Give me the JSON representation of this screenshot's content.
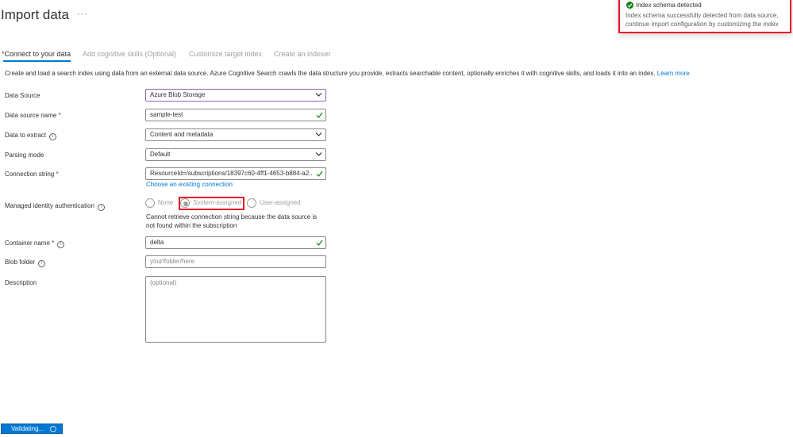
{
  "page": {
    "title": "Import data",
    "more_label": "···"
  },
  "tabs": [
    {
      "label": "Connect to your data",
      "required_marker": "*"
    },
    {
      "label": "Add cognitive skills (Optional)"
    },
    {
      "label": "Customize target index"
    },
    {
      "label": "Create an indexer"
    }
  ],
  "description": {
    "text": "Create and load a search index using data from an external data source. Azure Cognitive Search crawls the data structure you provide, extracts searchable content, optionally enriches it with cognitive skills, and loads it into an index.",
    "link": "Learn more"
  },
  "form": {
    "data_source": {
      "label": "Data Source",
      "value": "Azure Blob Storage"
    },
    "data_source_name": {
      "label": "Data source name",
      "required": "*",
      "value": "sample-test"
    },
    "data_to_extract": {
      "label": "Data to extract",
      "value": "Content and metadata"
    },
    "parsing_mode": {
      "label": "Parsing mode",
      "value": "Default"
    },
    "connection_string": {
      "label": "Connection string",
      "required": "*",
      "value": "ResourceId=/subscriptions/18397c60-4ff1-4653-b884-a2...",
      "link": "Choose an existing connection"
    },
    "managed_identity": {
      "label": "Managed identity authentication",
      "options": [
        "None",
        "System-assigned",
        "User-assigned"
      ],
      "selected": "System-assigned",
      "warning": "Cannot retrieve connection string because the data source is not found within the subscription"
    },
    "container_name": {
      "label": "Container name",
      "required": "*",
      "value": "delta"
    },
    "blob_folder": {
      "label": "Blob folder",
      "placeholder": "your/folder/here"
    },
    "description": {
      "label": "Description",
      "placeholder": "(optional)"
    }
  },
  "notification": {
    "title": "Index schema detected",
    "message": "Index schema successfully detected from data source, continue import configuration by customizing the index"
  },
  "status": {
    "label": "Validating..."
  },
  "colors": {
    "accent": "#0078d4",
    "highlight": "#e81123",
    "success": "#107c10",
    "required": "#a4262c"
  },
  "icons": {
    "info": "info-icon",
    "chevron": "chevron-down-icon",
    "check": "checkmark-icon",
    "success": "success-check-icon"
  }
}
